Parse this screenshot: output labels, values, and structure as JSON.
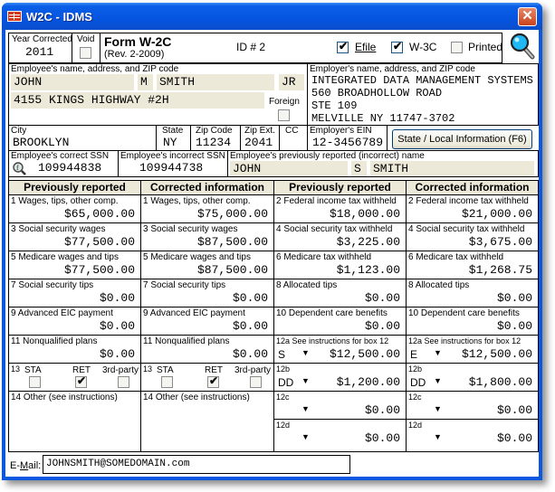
{
  "window": {
    "title": "W2C - IDMS",
    "close_label": "✕"
  },
  "header": {
    "year_corrected_label": "Year Corrected",
    "year_corrected_value": "2011",
    "void_label": "Void",
    "void_checked": false,
    "form_title": "Form W-2C",
    "form_rev": "(Rev. 2-2009)",
    "id_label": "ID # 2",
    "efile_label": "Efile",
    "efile_checked": true,
    "w3c_label": "W-3C",
    "w3c_checked": true,
    "printed_label": "Printed",
    "printed_checked": false
  },
  "employee": {
    "section_label": "Employee's name, address, and ZIP code",
    "first_name": "JOHN",
    "middle_initial": "M",
    "last_name": "SMITH",
    "suffix": "JR",
    "address1": "4155 KINGS HIGHWAY #2H",
    "address2": "",
    "foreign_label": "Foreign",
    "foreign_checked": false,
    "city_label": "City",
    "city": "BROOKLYN",
    "state_label": "State",
    "state": "NY",
    "zip_label": "Zip Code",
    "zip": "11234",
    "zip_ext_label": "Zip Ext.",
    "zip_ext": "2041",
    "cc_label": "CC",
    "cc": "",
    "correct_ssn_label": "Employee's correct SSN",
    "correct_ssn": "109944838",
    "incorrect_ssn_label": "Employee's incorrect SSN",
    "incorrect_ssn": "109944738",
    "prev_name_label": "Employee's previously reported (incorrect) name",
    "prev_first_name": "JOHN",
    "prev_middle_initial": "S",
    "prev_last_name": "SMITH"
  },
  "employer": {
    "section_label": "Employer's name, address, and ZIP code",
    "lines": [
      "INTEGRATED DATA MANAGEMENT SYSTEMS",
      "560 BROADHOLLOW ROAD",
      "STE 109",
      "MELVILLE NY 11747-3702"
    ],
    "ein_label": "Employer's EIN",
    "ein": "12-3456789",
    "state_local_button": "State / Local Information (F6)"
  },
  "columns": {
    "left_prev": "Previously reported",
    "left_corr": "Corrected information",
    "right_prev": "Previously reported",
    "right_corr": "Corrected information"
  },
  "boxes_left": [
    {
      "label": "1  Wages, tips, other comp.",
      "prev": "$65,000.00",
      "corr": "$75,000.00"
    },
    {
      "label": "3  Social security wages",
      "prev": "$77,500.00",
      "corr": "$87,500.00"
    },
    {
      "label": "5  Medicare wages and tips",
      "prev": "$77,500.00",
      "corr": "$87,500.00"
    },
    {
      "label": "7  Social security tips",
      "prev": "$0.00",
      "corr": "$0.00"
    },
    {
      "label": "9  Advanced EIC payment",
      "prev": "$0.00",
      "corr": "$0.00"
    },
    {
      "label": "11  Nonqualified plans",
      "prev": "$0.00",
      "corr": "$0.00"
    }
  ],
  "boxes_right": [
    {
      "label": "2  Federal income tax withheld",
      "prev": "$18,000.00",
      "corr": "$21,000.00"
    },
    {
      "label": "4  Social security tax withheld",
      "prev": "$3,225.00",
      "corr": "$3,675.00"
    },
    {
      "label": "6  Medicare tax withheld",
      "prev": "$1,123.00",
      "corr": "$1,268.75"
    },
    {
      "label": "8  Allocated tips",
      "prev": "$0.00",
      "corr": "$0.00"
    },
    {
      "label": "10  Dependent care benefits",
      "prev": "$0.00",
      "corr": "$0.00"
    }
  ],
  "box12": [
    {
      "label": "12a  See instructions for box 12",
      "prev_code": "S",
      "prev_amt": "$12,500.00",
      "corr_code": "E",
      "corr_amt": "$12,500.00"
    },
    {
      "label": "12b",
      "prev_code": "DD",
      "prev_amt": "$1,200.00",
      "corr_code": "DD",
      "corr_amt": "$1,800.00"
    },
    {
      "label": "12c",
      "prev_code": "",
      "prev_amt": "$0.00",
      "corr_code": "",
      "corr_amt": "$0.00"
    },
    {
      "label": "12d",
      "prev_code": "",
      "prev_amt": "$0.00",
      "corr_code": "",
      "corr_amt": "$0.00"
    }
  ],
  "box13": {
    "num": "13",
    "sta_label": "STA",
    "ret_label": "RET",
    "third_party_label": "3rd-party",
    "prev": {
      "sta": false,
      "ret": true,
      "third_party": false
    },
    "corr": {
      "sta": false,
      "ret": true,
      "third_party": false
    }
  },
  "box14": {
    "label": "14  Other (see instructions)",
    "prev": "",
    "corr": ""
  },
  "email": {
    "label": "E-Mail:",
    "value": "JOHNSMITH@SOMEDOMAIN.com"
  },
  "icons": {
    "dropdown": "▼",
    "check": "✔"
  }
}
